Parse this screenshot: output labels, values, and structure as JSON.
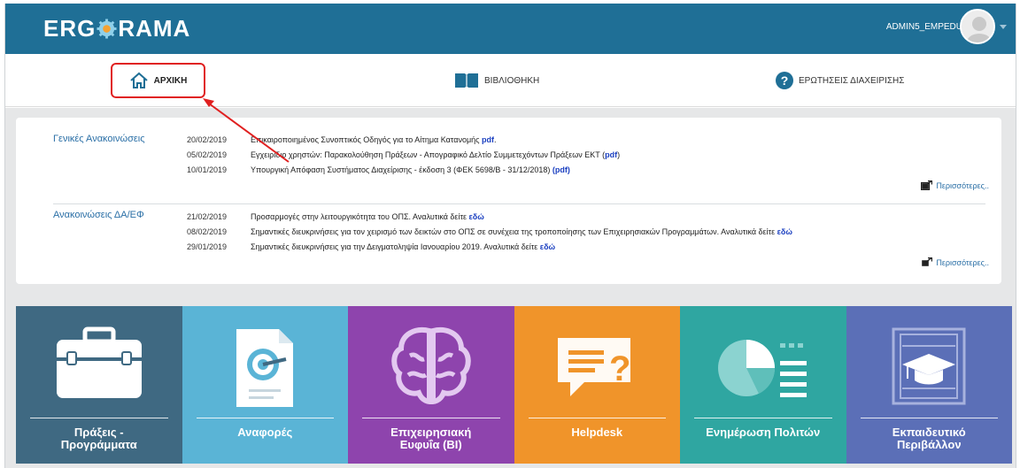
{
  "header": {
    "logo_left": "ERG",
    "logo_right": "RAMA",
    "user_name": "ADMIN5_EMPEDU"
  },
  "nav": {
    "home_label": "ΑΡΧΙΚΗ",
    "library_label": "ΒΙΒΛΙΟΘΗΚΗ",
    "faq_label": "ΕΡΩΤΗΣΕΙΣ ΔΙΑΧΕΙΡΙΣΗΣ"
  },
  "announcements": [
    {
      "title": "Γενικές Ανακοινώσεις",
      "more_label": "Περισσότερες..",
      "items": [
        {
          "date": "20/02/2019",
          "text": "Επικαιροποιημένος Συνοπτικός Οδηγός για το Αίτημα Κατανομής ",
          "link": "pdf",
          "suffix": "."
        },
        {
          "date": "05/02/2019",
          "text": "Εγχειρίδιο χρηστών: Παρακολούθηση Πράξεων - Απογραφικό Δελτίο Συμμετεχόντων Πράξεων ΕΚΤ (",
          "link": "pdf",
          "suffix": ")"
        },
        {
          "date": "10/01/2019",
          "text": "Υπουργική Απόφαση Συστήματος Διαχείρισης - έκδοση 3 (ΦΕΚ 5698/Β - 31/12/2018) ",
          "link": "(pdf)",
          "suffix": ""
        }
      ]
    },
    {
      "title": "Ανακοινώσεις ΔΑ/ΕΦ",
      "more_label": "Περισσότερες..",
      "items": [
        {
          "date": "21/02/2019",
          "text": "Προσαρμογές στην λειτουργικότητα του ΟΠΣ. Αναλυτικά δείτε ",
          "link": "εδώ",
          "suffix": ""
        },
        {
          "date": "08/02/2019",
          "text": "Σημαντικές διευκρινήσεις για τον χειρισμό των δεικτών στο ΟΠΣ σε συνέχεια της τροποποίησης των Επιχειρησιακών Προγραμμάτων. Αναλυτικά δείτε ",
          "link": "εδώ",
          "suffix": ""
        },
        {
          "date": "29/01/2019",
          "text": "Σημαντικές διευκρινήσεις για την Δειγματοληψία Ιανουαρίου 2019. Αναλυτικά δείτε ",
          "link": "εδώ",
          "suffix": ""
        }
      ]
    }
  ],
  "tiles": [
    {
      "label_1": "Πράξεις -",
      "label_2": "Προγράμματα",
      "color": "#3f6982",
      "icon": "briefcase-icon"
    },
    {
      "label_1": "Αναφορές",
      "label_2": "",
      "color": "#5ab4d6",
      "icon": "report-target-icon"
    },
    {
      "label_1": "Επιχειρησιακή",
      "label_2": "Ευφυΐα (BI)",
      "color": "#8e44ad",
      "icon": "brain-icon"
    },
    {
      "label_1": "Helpdesk",
      "label_2": "",
      "color": "#f0942a",
      "icon": "chat-question-icon"
    },
    {
      "label_1": "Ενημέρωση Πολιτών",
      "label_2": "",
      "color": "#2fa6a1",
      "icon": "pie-chart-icon"
    },
    {
      "label_1": "Εκπαιδευτικό",
      "label_2": "Περιβάλλον",
      "color": "#5b6fb7",
      "icon": "graduation-book-icon"
    }
  ],
  "colors": {
    "header_bg": "#1f6f96",
    "highlight": "#e02020",
    "link": "#2a6fa6"
  }
}
